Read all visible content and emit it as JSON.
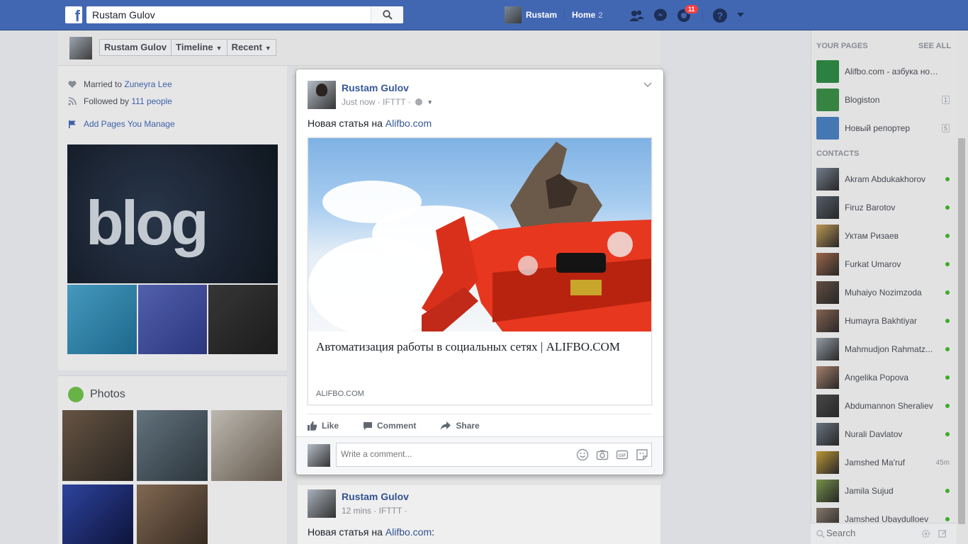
{
  "topbar": {
    "search_value": "Rustam Gulov",
    "user_name": "Rustam",
    "home_label": "Home",
    "home_count": "2",
    "notification_count": "11"
  },
  "profile": {
    "tabs": [
      "Rustam Gulov",
      "Timeline",
      "Recent"
    ],
    "intro": {
      "married_prefix": "Married to",
      "married_name": "Zuneyra Lee",
      "followed_prefix": "Followed by",
      "followed_link": "111 people",
      "add_pages": "Add Pages You Manage"
    },
    "photos_title": "Photos"
  },
  "modal_post": {
    "author": "Rustam Gulov",
    "meta": "Just now · IFTTT ·",
    "text_prefix": "Новая статья на",
    "text_link": "Alifbo.com",
    "link_title": "Автоматизация работы в социальных сетях | ALIFBO.COM",
    "link_domain": "ALIFBO.COM",
    "actions": {
      "like": "Like",
      "comment": "Comment",
      "share": "Share"
    },
    "comment_placeholder": "Write a comment..."
  },
  "second_post": {
    "author": "Rustam Gulov",
    "meta": "12 mins · IFTTT ·",
    "text_prefix": "Новая статья на",
    "text_link": "Alifbo.com",
    "text_suffix": ":"
  },
  "right_column": {
    "pages_heading": "YOUR PAGES",
    "see_all": "SEE ALL",
    "pages": [
      {
        "name": "Alifbo.com - азбука новы...",
        "count": ""
      },
      {
        "name": "Blogiston",
        "count": "1"
      },
      {
        "name": "Новый репортер",
        "count": "5"
      }
    ],
    "contacts_heading": "CONTACTS",
    "contacts": [
      {
        "name": "Akram Abdukakhorov",
        "status": "online"
      },
      {
        "name": "Firuz Barotov",
        "status": "online"
      },
      {
        "name": "Уктам Ризаев",
        "status": "online"
      },
      {
        "name": "Furkat Umarov",
        "status": "online"
      },
      {
        "name": "Muhaiyo Nozimzoda",
        "status": "online"
      },
      {
        "name": "Humayra Bakhtiyar",
        "status": "online"
      },
      {
        "name": "Mahmudjon Rahmatz...",
        "status": "online"
      },
      {
        "name": "Angelika Popova",
        "status": "online"
      },
      {
        "name": "Abdumannon Sheraliev",
        "status": "online"
      },
      {
        "name": "Nurali Davlatov",
        "status": "online"
      },
      {
        "name": "Jamshed Ma'ruf",
        "status": "45m"
      },
      {
        "name": "Jamila Sujud",
        "status": "online"
      },
      {
        "name": "Jamshed Ubaydulloev",
        "status": "online"
      }
    ],
    "search_placeholder": "Search"
  },
  "colors": {
    "brand_blue": "#4267b2",
    "link_blue": "#365899",
    "online_green": "#42b72a",
    "notification_red": "#fa3e3e"
  },
  "icons": [
    "facebook-logo-icon",
    "search-icon",
    "friend-requests-icon",
    "messenger-icon",
    "notifications-icon",
    "help-icon",
    "chevron-down-icon",
    "globe-icon",
    "like-icon",
    "comment-icon",
    "share-icon",
    "emoji-icon",
    "camera-icon",
    "gif-icon",
    "sticker-icon",
    "heart-icon",
    "rss-icon",
    "flag-icon",
    "photos-icon",
    "settings-icon",
    "compose-icon"
  ]
}
